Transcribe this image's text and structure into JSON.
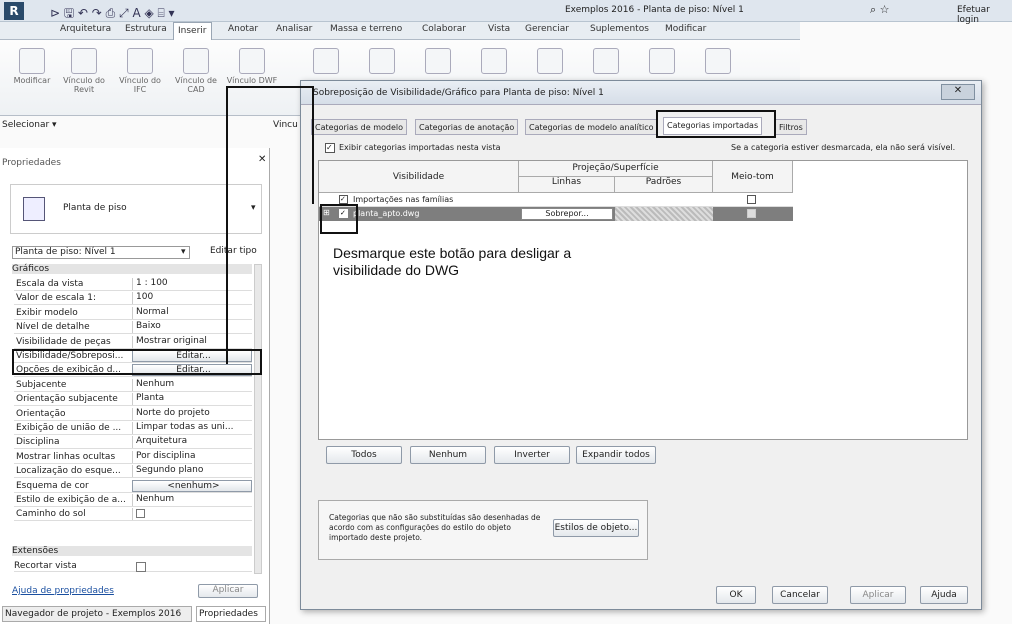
{
  "titlebar": {
    "title": "Exemplos 2016 - Planta de piso: Nível 1",
    "login": "Efetuar login"
  },
  "ribbon_tabs": [
    "Arquitetura",
    "Estrutura",
    "Inserir",
    "Anotar",
    "Analisar",
    "Massa e terreno",
    "Colaborar",
    "Vista",
    "Gerenciar",
    "Suplementos",
    "Modificar"
  ],
  "ribbon_buttons": [
    "Modificar",
    "Vínculo do Revit",
    "Vínculo do IFC",
    "Vínculo de CAD",
    "Vínculo DWF"
  ],
  "ribbon_panel": {
    "selecionar": "Selecionar ▾",
    "vinculo": "Vincu"
  },
  "properties": {
    "title": "Propriedades",
    "type_name": "Planta de piso",
    "instance": "Planta de piso: Nível 1",
    "edit_type": "Editar tipo",
    "group_graficos": "Gráficos",
    "rows": [
      {
        "k": "Escala da vista",
        "v": "1 : 100"
      },
      {
        "k": "Valor de escala  1:",
        "v": "100"
      },
      {
        "k": "Exibir modelo",
        "v": "Normal"
      },
      {
        "k": "Nível de detalhe",
        "v": "Baixo"
      },
      {
        "k": "Visibilidade de peças",
        "v": "Mostrar original"
      },
      {
        "k": "Visibilidade/Sobreposi...",
        "v": "Editar..."
      },
      {
        "k": "Opções de exibição d...",
        "v": "Editar..."
      },
      {
        "k": "Subjacente",
        "v": "Nenhum"
      },
      {
        "k": "Orientação subjacente",
        "v": "Planta"
      },
      {
        "k": "Orientação",
        "v": "Norte do projeto"
      },
      {
        "k": "Exibição de união de ...",
        "v": "Limpar todas as uni..."
      },
      {
        "k": "Disciplina",
        "v": "Arquitetura"
      },
      {
        "k": "Mostrar linhas ocultas",
        "v": "Por disciplina"
      },
      {
        "k": "Localização do esque...",
        "v": "Segundo plano"
      },
      {
        "k": "Esquema de cor",
        "v": "<nenhum>"
      },
      {
        "k": "Estilo de exibição de a...",
        "v": "Nenhum"
      },
      {
        "k": "Caminho do sol",
        "v": ""
      }
    ],
    "group_extensoes": "Extensões",
    "recortar": "Recortar vista",
    "help": "Ajuda de propriedades",
    "apply": "Aplicar",
    "bottom_tab_nav": "Navegador de projeto - Exemplos 2016",
    "bottom_tab_props": "Propriedades"
  },
  "dialog": {
    "title": "Sobreposição de Visibilidade/Gráfico para Planta de piso: Nível 1",
    "tabs": [
      "Categorias de modelo",
      "Categorias de anotação",
      "Categorias de modelo analítico",
      "Categorias importadas",
      "Filtros"
    ],
    "show_checkbox": "Exibir categorias importadas nesta vista",
    "hint": "Se a categoria estiver desmarcada, ela não será visível.",
    "col_visibilidade": "Visibilidade",
    "col_projecao": "Projeção/Superfície",
    "col_linhas": "Linhas",
    "col_padroes": "Padrões",
    "col_meio_tom": "Meio-tom",
    "row1": "Importações nas famílias",
    "row2": "planta_apto.dwg",
    "row2_linhas": "Sobrepor...",
    "annotation": "Desmarque este botão para desligar a visibilidade do DWG",
    "btn_todos": "Todos",
    "btn_nenhum": "Nenhum",
    "btn_inverter": "Inverter",
    "btn_expandir": "Expandir todos",
    "note": "Categorias que não são substituídas são desenhadas de acordo com as configurações do estilo do objeto importado deste projeto.",
    "btn_estilos": "Estilos de objeto...",
    "btn_ok": "OK",
    "btn_cancelar": "Cancelar",
    "btn_aplicar": "Aplicar",
    "btn_ajuda": "Ajuda"
  }
}
